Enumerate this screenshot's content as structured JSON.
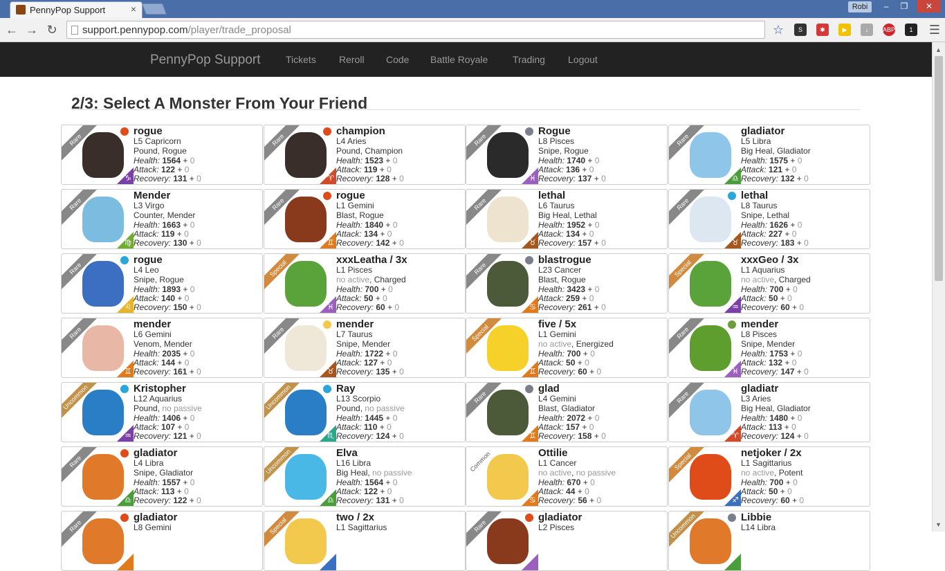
{
  "browser": {
    "tab_title": "PennyPop Support",
    "tab_close": "×",
    "profile": "Robi",
    "url_host": "support.pennypop.com",
    "url_path": "/player/trade_proposal"
  },
  "navbar": {
    "brand": "PennyPop Support",
    "links": [
      "Tickets",
      "Reroll",
      "Code",
      "Battle Royale",
      "Trading",
      "Logout"
    ]
  },
  "heading": "2/3: Select A Monster From Your Friend",
  "colors": {
    "fire": "#e04b1a",
    "water": "#2aa6d9",
    "stone": "#7a7f8c",
    "earth": "#6a9e3a",
    "light": "#f2c94c",
    "rare": "#888888",
    "special": "#d18b3f",
    "uncommon": "#c2924a"
  },
  "labels": {
    "health": "Health:",
    "attack": "Attack:",
    "recovery": "Recovery:",
    "plus": "+",
    "zero": "0"
  },
  "monsters": [
    {
      "rarity": "Rare",
      "element": "fire",
      "name": "rogue",
      "title": "L5 Capricorn",
      "ability": "Pound",
      "passive": "Rogue",
      "health": "1564",
      "attack": "122",
      "recovery": "131",
      "avatar": "#3a2e2a",
      "zcolor": "#7b3fa8",
      "zsym": "♑"
    },
    {
      "rarity": "Rare",
      "element": "fire",
      "name": "champion",
      "title": "L4 Aries",
      "ability": "Pound",
      "passive": "Champion",
      "health": "1523",
      "attack": "119",
      "recovery": "128",
      "avatar": "#3a2e2a",
      "zcolor": "#d14b2a",
      "zsym": "♈"
    },
    {
      "rarity": "Rare",
      "element": "stone",
      "name": "Rogue",
      "title": "L8 Pisces",
      "ability": "Snipe",
      "passive": "Rogue",
      "health": "1740",
      "attack": "136",
      "recovery": "137",
      "avatar": "#2a2a2a",
      "zcolor": "#9b5fc0",
      "zsym": "♓"
    },
    {
      "rarity": "Rare",
      "element": "",
      "name": "gladiator",
      "title": "L5 Libra",
      "ability": "Big Heal",
      "passive": "Gladiator",
      "health": "1575",
      "attack": "121",
      "recovery": "132",
      "avatar": "#8ec5e8",
      "zcolor": "#4a9e3a",
      "zsym": "♎"
    },
    {
      "rarity": "Rare",
      "element": "",
      "name": "Mender",
      "title": "L3 Virgo",
      "ability": "Counter",
      "passive": "Mender",
      "health": "1663",
      "attack": "119",
      "recovery": "130",
      "avatar": "#7bbce0",
      "zcolor": "#6fae2a",
      "zsym": "♍"
    },
    {
      "rarity": "Rare",
      "element": "fire",
      "name": "rogue",
      "title": "L1 Gemini",
      "ability": "Blast",
      "passive": "Rogue",
      "health": "1840",
      "attack": "134",
      "recovery": "142",
      "avatar": "#8a3a1c",
      "zcolor": "#e07a1a",
      "zsym": "♊"
    },
    {
      "rarity": "Rare",
      "element": "",
      "name": "lethal",
      "title": "L6 Taurus",
      "ability": "Big Heal",
      "passive": "Lethal",
      "health": "1952",
      "attack": "134",
      "recovery": "157",
      "avatar": "#ede3cf",
      "zcolor": "#a8561c",
      "zsym": "♉"
    },
    {
      "rarity": "Rare",
      "element": "water",
      "name": "lethal",
      "title": "L8 Taurus",
      "ability": "Snipe",
      "passive": "Lethal",
      "health": "1626",
      "attack": "227",
      "recovery": "183",
      "avatar": "#dde7f2",
      "zcolor": "#a8561c",
      "zsym": "♉"
    },
    {
      "rarity": "Rare",
      "element": "water",
      "name": "rogue",
      "title": "L4 Leo",
      "ability": "Snipe",
      "passive": "Rogue",
      "health": "1893",
      "attack": "140",
      "recovery": "150",
      "avatar": "#3c6fc2",
      "zcolor": "#e8b428",
      "zsym": "♌"
    },
    {
      "rarity": "Special",
      "element": "",
      "name": "xxxLeatha / 3x",
      "title": "L1 Pisces",
      "ability": "no active",
      "passive": "Charged",
      "health": "700",
      "attack": "50",
      "recovery": "60",
      "avatar": "#5aa33a",
      "zcolor": "#9b5fc0",
      "zsym": "♓"
    },
    {
      "rarity": "Rare",
      "element": "stone",
      "name": "blastrogue",
      "title": "L23 Cancer",
      "ability": "Blast",
      "passive": "Rogue",
      "health": "3423",
      "attack": "259",
      "recovery": "261",
      "avatar": "#4d5a3a",
      "zcolor": "#e07a1a",
      "zsym": "♋"
    },
    {
      "rarity": "Special",
      "element": "",
      "name": "xxxGeo / 3x",
      "title": "L1 Aquarius",
      "ability": "no active",
      "passive": "Charged",
      "health": "700",
      "attack": "50",
      "recovery": "60",
      "avatar": "#5aa33a",
      "zcolor": "#7b3fa8",
      "zsym": "♒"
    },
    {
      "rarity": "Rare",
      "element": "",
      "name": "mender",
      "title": "L6 Gemini",
      "ability": "Venom",
      "passive": "Mender",
      "health": "2035",
      "attack": "144",
      "recovery": "161",
      "avatar": "#e8b7a6",
      "zcolor": "#e07a1a",
      "zsym": "♊"
    },
    {
      "rarity": "Rare",
      "element": "light",
      "name": "mender",
      "title": "L7 Taurus",
      "ability": "Snipe",
      "passive": "Mender",
      "health": "1722",
      "attack": "127",
      "recovery": "135",
      "avatar": "#efe8d8",
      "zcolor": "#a8561c",
      "zsym": "♉"
    },
    {
      "rarity": "Special",
      "element": "",
      "name": "five / 5x",
      "title": "L1 Gemini",
      "ability": "no active",
      "passive": "Energized",
      "health": "700",
      "attack": "50",
      "recovery": "60",
      "avatar": "#f5d12a",
      "zcolor": "#e07a1a",
      "zsym": "♊"
    },
    {
      "rarity": "Rare",
      "element": "earth",
      "name": "mender",
      "title": "L8 Pisces",
      "ability": "Snipe",
      "passive": "Mender",
      "health": "1753",
      "attack": "132",
      "recovery": "147",
      "avatar": "#5e9e2e",
      "zcolor": "#9b5fc0",
      "zsym": "♓"
    },
    {
      "rarity": "Uncommon",
      "element": "water",
      "name": "Kristopher",
      "title": "L12 Aquarius",
      "ability": "Pound",
      "passive": "no passive",
      "health": "1406",
      "attack": "107",
      "recovery": "121",
      "avatar": "#2a7ec6",
      "zcolor": "#7b3fa8",
      "zsym": "♒"
    },
    {
      "rarity": "Uncommon",
      "element": "water",
      "name": "Ray",
      "title": "L13 Scorpio",
      "ability": "Pound",
      "passive": "no passive",
      "health": "1445",
      "attack": "110",
      "recovery": "124",
      "avatar": "#2a7ec6",
      "zcolor": "#2aa68a",
      "zsym": "♏"
    },
    {
      "rarity": "Rare",
      "element": "stone",
      "name": "glad",
      "title": "L4 Gemini",
      "ability": "Blast",
      "passive": "Gladiator",
      "health": "2072",
      "attack": "157",
      "recovery": "158",
      "avatar": "#4d5a3a",
      "zcolor": "#e07a1a",
      "zsym": "♊"
    },
    {
      "rarity": "Rare",
      "element": "",
      "name": "gladiatr",
      "title": "L3 Aries",
      "ability": "Big Heal",
      "passive": "Gladiator",
      "health": "1480",
      "attack": "113",
      "recovery": "124",
      "avatar": "#8ec5e8",
      "zcolor": "#d14b2a",
      "zsym": "♈"
    },
    {
      "rarity": "Rare",
      "element": "fire",
      "name": "gladiator",
      "title": "L4 Libra",
      "ability": "Snipe",
      "passive": "Gladiator",
      "health": "1557",
      "attack": "113",
      "recovery": "122",
      "avatar": "#e07a2a",
      "zcolor": "#4a9e3a",
      "zsym": "♎"
    },
    {
      "rarity": "Uncommon",
      "element": "",
      "name": "Elva",
      "title": "L16 Libra",
      "ability": "Big Heal",
      "passive": "no passive",
      "health": "1564",
      "attack": "122",
      "recovery": "131",
      "avatar": "#4ab8e6",
      "zcolor": "#4a9e3a",
      "zsym": "♎"
    },
    {
      "rarity": "Common",
      "element": "",
      "name": "Ottilie",
      "title": "L1 Cancer",
      "ability": "no active",
      "passive": "no passive",
      "health": "670",
      "attack": "44",
      "recovery": "56",
      "avatar": "#f2c94c",
      "zcolor": "#e07a1a",
      "zsym": "♋"
    },
    {
      "rarity": "Special",
      "element": "",
      "name": "netjoker / 2x",
      "title": "L1 Sagittarius",
      "ability": "no active",
      "passive": "Potent",
      "health": "700",
      "attack": "50",
      "recovery": "60",
      "avatar": "#e04b1a",
      "zcolor": "#3a6fc2",
      "zsym": "♐"
    },
    {
      "rarity": "Rare",
      "element": "fire",
      "name": "gladiator",
      "title": "L8 Gemini",
      "ability": "",
      "passive": "",
      "health": "",
      "attack": "",
      "recovery": "",
      "avatar": "#e07a2a",
      "zcolor": "#e07a1a",
      "zsym": ""
    },
    {
      "rarity": "Special",
      "element": "",
      "name": "two / 2x",
      "title": "L1 Sagittarius",
      "ability": "",
      "passive": "",
      "health": "",
      "attack": "",
      "recovery": "",
      "avatar": "#f2c94c",
      "zcolor": "#3a6fc2",
      "zsym": ""
    },
    {
      "rarity": "Rare",
      "element": "fire",
      "name": "gladiator",
      "title": "L2 Pisces",
      "ability": "",
      "passive": "",
      "health": "",
      "attack": "",
      "recovery": "",
      "avatar": "#8a3a1c",
      "zcolor": "#9b5fc0",
      "zsym": ""
    },
    {
      "rarity": "Uncommon",
      "element": "stone",
      "name": "Libbie",
      "title": "L14 Libra",
      "ability": "",
      "passive": "",
      "health": "",
      "attack": "",
      "recovery": "",
      "avatar": "#e07a2a",
      "zcolor": "#4a9e3a",
      "zsym": ""
    }
  ]
}
